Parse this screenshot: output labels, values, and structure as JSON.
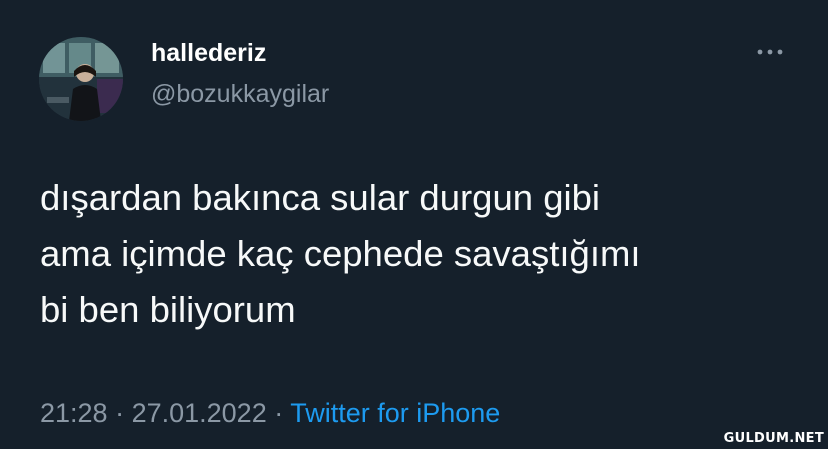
{
  "user": {
    "display_name": "hallederiz",
    "handle": "@bozukkaygilar",
    "avatar_icon": "profile-photo"
  },
  "menu": {
    "icon": "more-horizontal-icon"
  },
  "tweet": {
    "lines": [
      "dışardan bakınca sular durgun gibi",
      "ama içimde kaç cephede savaştığımı",
      "bi ben biliyorum"
    ]
  },
  "meta": {
    "time": "21:28",
    "separator_1": " · ",
    "date": "27.01.2022",
    "separator_2": " · ",
    "source": "Twitter for iPhone"
  },
  "watermark": "GULDUM.NET",
  "colors": {
    "background": "#15202b",
    "text": "#f7f9f9",
    "secondary": "#8b98a5",
    "accent": "#1d9bf0"
  }
}
